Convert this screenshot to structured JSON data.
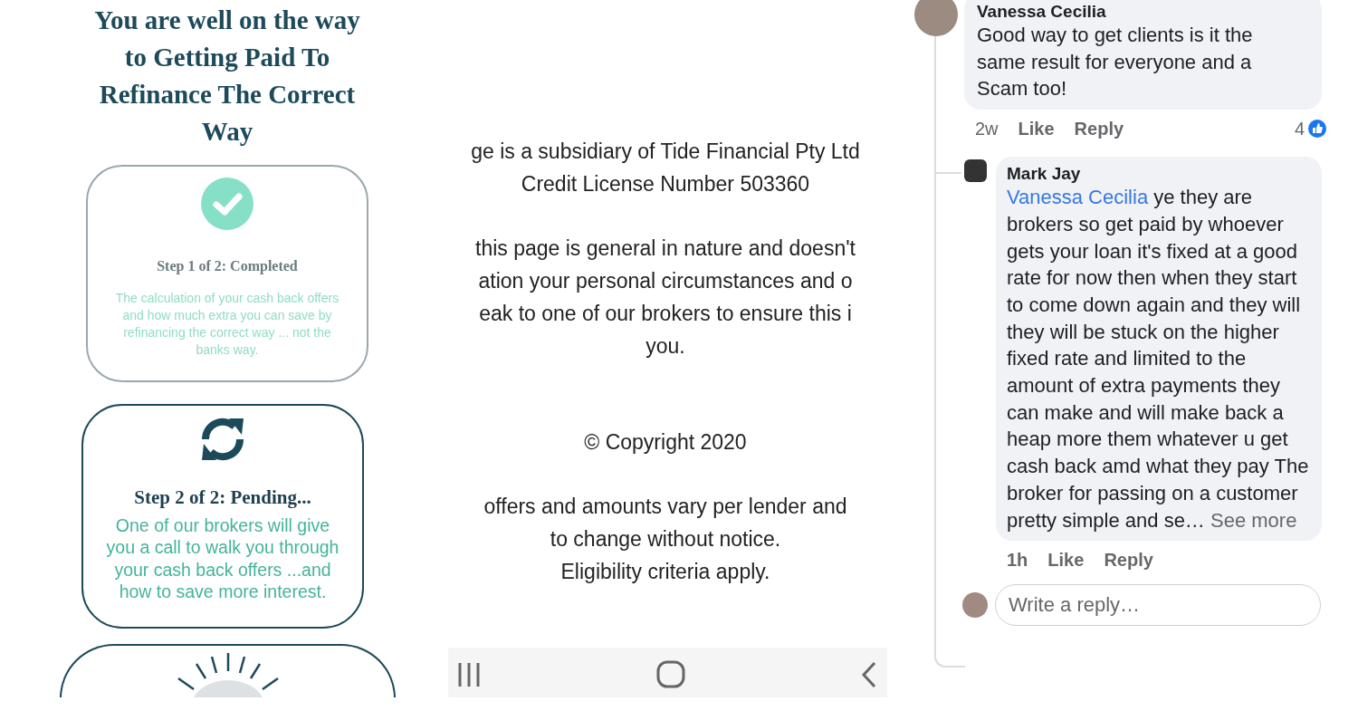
{
  "steps_page": {
    "headline": "You are well on the way to Getting Paid To Refinance The Correct Way",
    "steps": [
      {
        "kind": "completed",
        "title": "Step 1 of 2: Completed",
        "description": "The calculation of your cash back offers and how much extra you can save by refinancing the correct way ... not the banks way."
      },
      {
        "kind": "pending",
        "title": "Step 2 of 2: Pending...",
        "description": "One of our brokers will give you a call to walk you through your cash back offers ...and how to save more interest."
      },
      {
        "kind": "upcoming"
      }
    ]
  },
  "disclaimer": {
    "paragraphs": [
      [
        "ge is a subsidiary of Tide Financial Pty Ltd",
        "Credit License Number 503360"
      ],
      [
        "this page is general in nature and doesn't",
        "ation your personal circumstances and o",
        "eak to one of our brokers to ensure this i",
        "you."
      ]
    ],
    "copyright": "© Copyright 2020",
    "notice": [
      "offers and amounts vary per lender and",
      "to change without notice.",
      "Eligibility criteria apply."
    ]
  },
  "comments": [
    {
      "author": "Vanessa Cecilia",
      "text": "Good way to get clients is it the same result for everyone and a Scam too!",
      "time": "2w",
      "actions": [
        "Like",
        "Reply"
      ],
      "reaction_count": "4",
      "replies": [
        {
          "author": "Mark Jay",
          "mention": "Vanessa Cecilia",
          "text": "ye they are brokers so get paid by whoever gets your loan it's fixed at a good rate for now then when they start to come down again and they will they will be stuck on the higher fixed rate and limited to the amount of extra payments they can make and will make back a heap more them whatever u get cash back amd what they pay The broker for passing on a customer pretty simple and se…",
          "see_more": "See more",
          "time": "1h",
          "actions": [
            "Like",
            "Reply"
          ]
        }
      ]
    }
  ],
  "reply_box": {
    "placeholder": "Write a reply…"
  }
}
